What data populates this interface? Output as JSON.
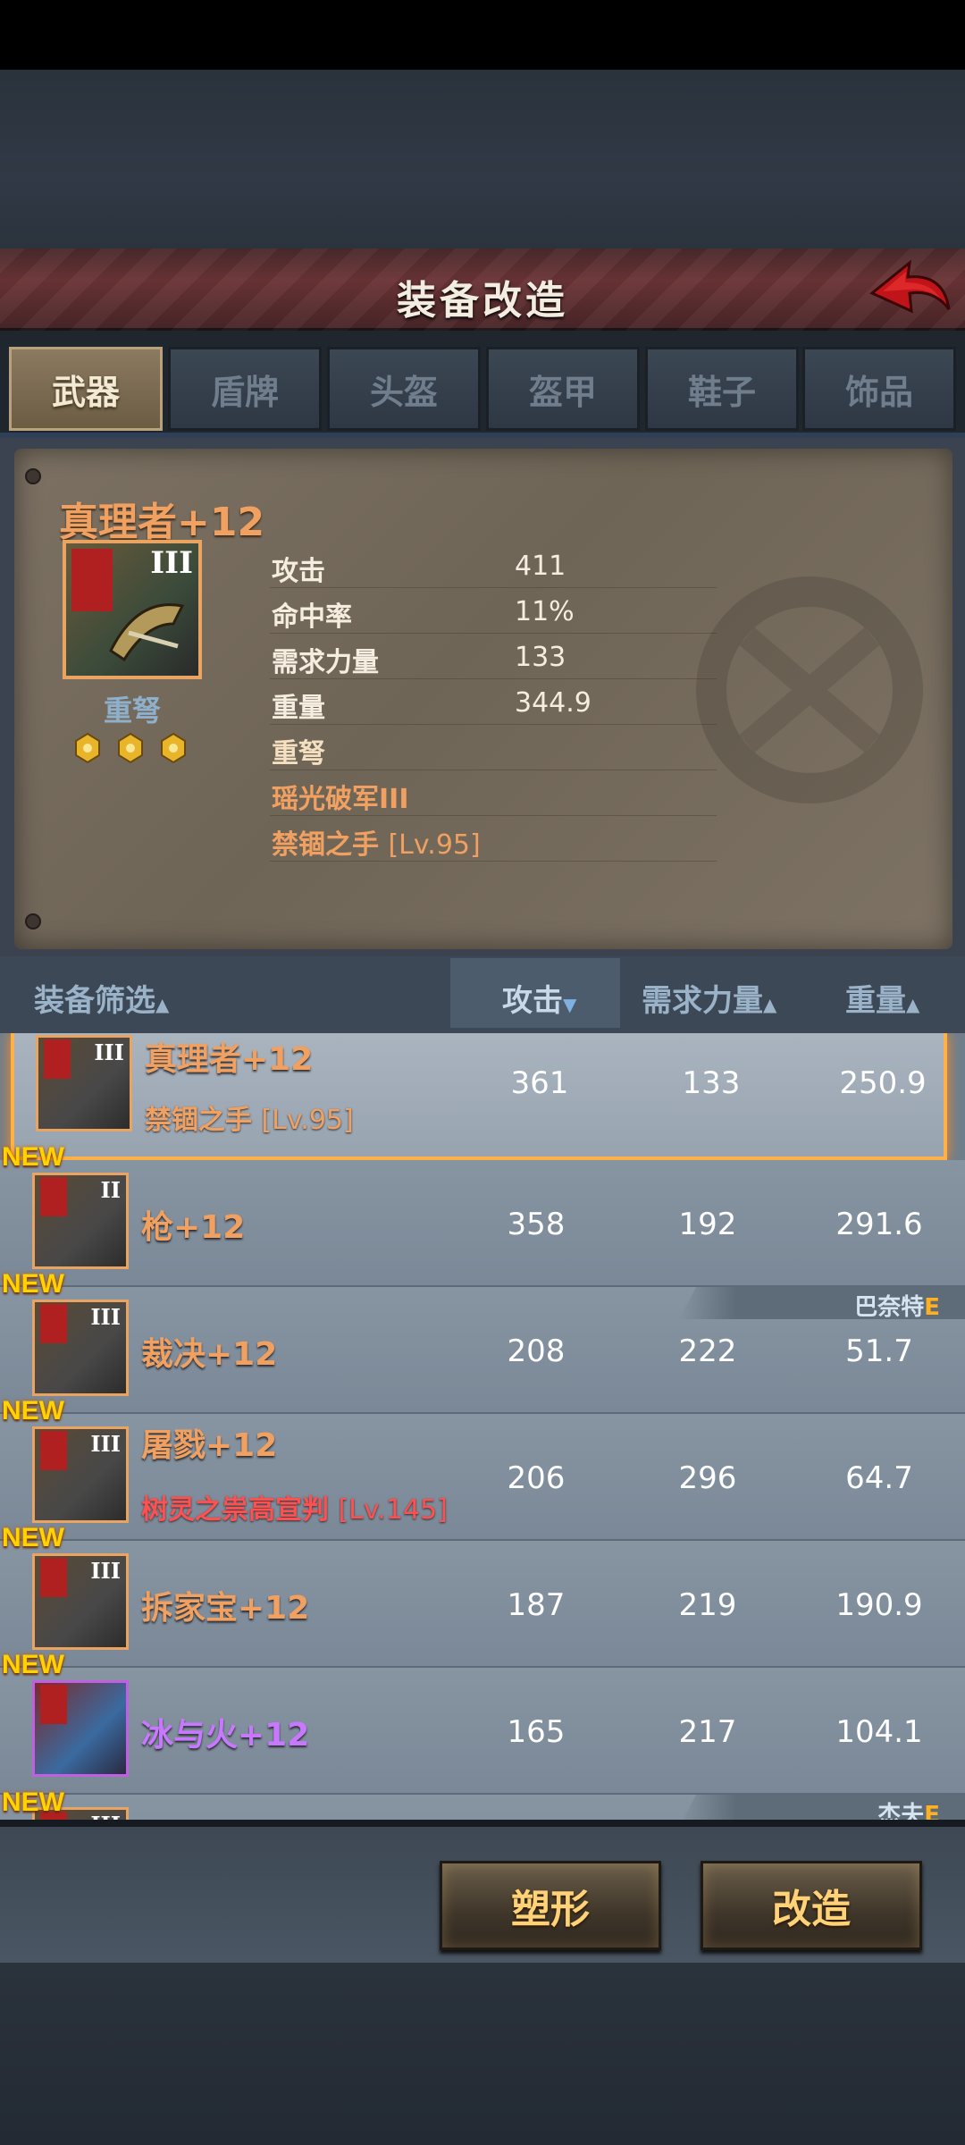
{
  "header": {
    "title": "装备改造"
  },
  "tabs": [
    {
      "label": "武器",
      "active": true
    },
    {
      "label": "盾牌",
      "active": false
    },
    {
      "label": "头盔",
      "active": false
    },
    {
      "label": "盔甲",
      "active": false
    },
    {
      "label": "鞋子",
      "active": false
    },
    {
      "label": "饰品",
      "active": false
    }
  ],
  "detail": {
    "name": "真理者+12",
    "tier": "III",
    "type": "重弩",
    "stars": 3,
    "stats": [
      {
        "label": "攻击",
        "value": "411"
      },
      {
        "label": "命中率",
        "value": "11%"
      },
      {
        "label": "需求力量",
        "value": "133"
      },
      {
        "label": "重量",
        "value": "344.9"
      }
    ],
    "extra_type": "重弩",
    "skill": "瑶光破军III",
    "set_name": "禁锢之手",
    "set_level": "[Lv.95]"
  },
  "list_header": {
    "filter": "装备筛选",
    "attack": "攻击",
    "strength": "需求力量",
    "weight": "重量"
  },
  "list": [
    {
      "name": "真理者+12",
      "tier": "III",
      "attack": "361",
      "strength": "133",
      "weight": "250.9",
      "sub": "禁锢之手",
      "sub_level": "[Lv.95]",
      "new": false,
      "selected": true
    },
    {
      "name": "枪+12",
      "tier": "II",
      "attack": "358",
      "strength": "192",
      "weight": "291.6",
      "new_label": "NEW"
    },
    {
      "name": "裁决+12",
      "tier": "III",
      "attack": "208",
      "strength": "222",
      "weight": "51.7",
      "new_label": "NEW",
      "tag_name": "巴奈特",
      "tag_grade": "E"
    },
    {
      "name": "屠戮+12",
      "tier": "III",
      "attack": "206",
      "strength": "296",
      "weight": "64.7",
      "new_label": "NEW",
      "sub": "树灵之祟高宣判",
      "sub_level": "[Lv.145]"
    },
    {
      "name": "拆家宝+12",
      "tier": "III",
      "attack": "187",
      "strength": "219",
      "weight": "190.9",
      "new_label": "NEW"
    },
    {
      "name": "冰与火+12",
      "tier": "",
      "attack": "165",
      "strength": "217",
      "weight": "104.1",
      "new_label": "NEW",
      "rarity": "purple"
    },
    {
      "name": "",
      "tier": "III",
      "new_label": "NEW",
      "tag_name": "杰夫",
      "tag_grade": "E"
    }
  ],
  "buttons": {
    "reshape": "塑形",
    "modify": "改造"
  },
  "colors": {
    "accent": "#f0a060",
    "new": "#ffd200",
    "selected_border": "#ffb047",
    "purple": "#c878ff"
  }
}
